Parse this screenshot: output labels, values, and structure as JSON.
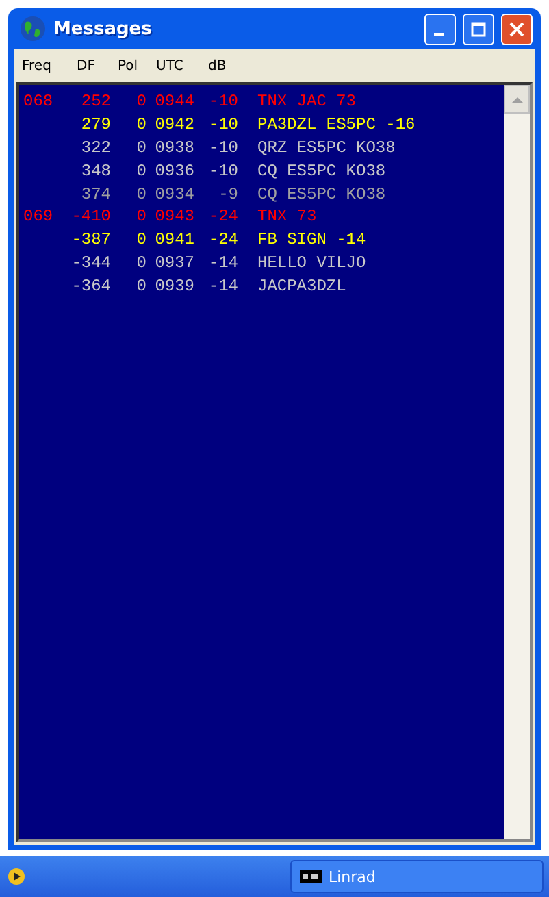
{
  "window": {
    "title": "Messages"
  },
  "columns": [
    "Freq",
    "DF",
    "Pol",
    "UTC",
    "dB"
  ],
  "rows": [
    {
      "freq": "068",
      "df": "252",
      "pol": "0",
      "utc": "0944",
      "db": "-10",
      "message": "TNX JAC 73",
      "color": "#ff0000"
    },
    {
      "freq": "",
      "df": "279",
      "pol": "0",
      "utc": "0942",
      "db": "-10",
      "message": "PA3DZL ES5PC -16",
      "color": "#ffff00"
    },
    {
      "freq": "",
      "df": "322",
      "pol": "0",
      "utc": "0938",
      "db": "-10",
      "message": "QRZ ES5PC KO38",
      "color": "#c8c8c8"
    },
    {
      "freq": "",
      "df": "348",
      "pol": "0",
      "utc": "0936",
      "db": "-10",
      "message": "CQ ES5PC KO38",
      "color": "#c8c8c8"
    },
    {
      "freq": "",
      "df": "374",
      "pol": "0",
      "utc": "0934",
      "db": "-9",
      "message": "CQ ES5PC KO38",
      "color": "#a0a0a0"
    },
    {
      "freq": "069",
      "df": "-410",
      "pol": "0",
      "utc": "0943",
      "db": "-24",
      "message": "TNX 73",
      "color": "#ff0000"
    },
    {
      "freq": "",
      "df": "-387",
      "pol": "0",
      "utc": "0941",
      "db": "-24",
      "message": "FB SIGN -14",
      "color": "#ffff00"
    },
    {
      "freq": "",
      "df": "-344",
      "pol": "0",
      "utc": "0937",
      "db": "-14",
      "message": "HELLO VILJO",
      "color": "#c8c8c8"
    },
    {
      "freq": "",
      "df": "-364",
      "pol": "0",
      "utc": "0939",
      "db": "-14",
      "message": "JACPA3DZL",
      "color": "#c8c8c8"
    }
  ],
  "taskbar": {
    "buttons": [
      {
        "label": "Linrad"
      }
    ]
  }
}
